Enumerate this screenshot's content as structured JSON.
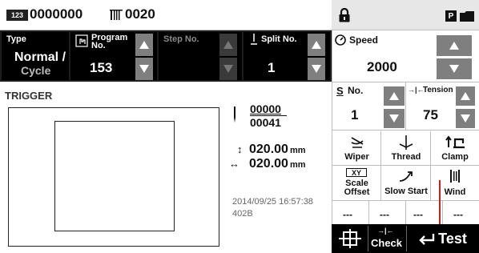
{
  "header": {
    "counter_icon_text": "123",
    "counter_value": "0000000",
    "stitch_icon": "stitch-count-icon",
    "stitch_value": "0020",
    "lock_icon": "lock-icon",
    "p_icon_text": "P",
    "folder_icon": "folder-icon"
  },
  "params": {
    "type_label": "Type",
    "type_value_line1": "Normal /",
    "type_value_line2": "Cycle",
    "program_label_line1": "Program",
    "program_label_line2": "No.",
    "program_value": "153",
    "step_label": "Step No.",
    "split_label": "Split No.",
    "split_value": "1"
  },
  "trigger": {
    "label": "TRIGGER",
    "count_current": "00000",
    "count_total": "00041",
    "vertical_value": "020.00",
    "horizontal_value": "020.00",
    "unit": "mm",
    "timestamp": "2014/09/25 16:57:38",
    "file_id": "402B"
  },
  "right": {
    "speed_label": "Speed",
    "speed_value": "2000",
    "s_no_label": "No.",
    "s_no_value": "1",
    "tension_label": "Tension",
    "tension_value": "75",
    "wiper_label": "Wiper",
    "thread_label": "Thread",
    "clamp_label": "Clamp",
    "scale_offset_line1": "Scale",
    "scale_offset_line2": "Offset",
    "slow_start_label": "Slow Start",
    "wind_label": "Wind",
    "dashes": [
      "---",
      "---",
      "---",
      "---"
    ],
    "xy_icon_text": "XY"
  },
  "bottom": {
    "check_label": "Check",
    "test_label": "Test"
  },
  "colors": {
    "dark_bar": "#1d1d1d",
    "arrow_button": "#7f7f7f",
    "header_right": "#e7e7e7",
    "accent_line": "#d11a1a"
  }
}
